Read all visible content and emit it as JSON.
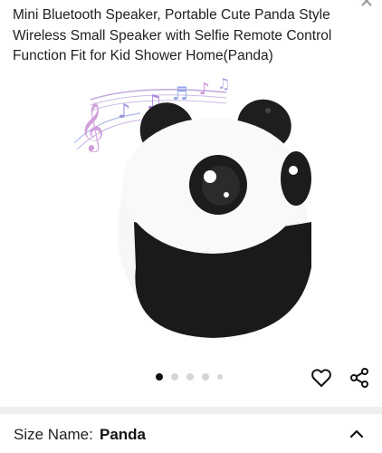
{
  "product": {
    "title": "Mini Bluetooth Speaker, Portable Cute Panda Style Wireless Small Speaker with Selfie Remote Control Function Fit for Kid Shower Home(Panda)"
  },
  "carousel": {
    "total_images": 5,
    "active_index": 0
  },
  "size_selector": {
    "label": "Size Name:",
    "value": "Panda"
  },
  "icons": {
    "wishlist": "heart-icon",
    "share": "share-icon",
    "expand": "chevron-up-icon"
  }
}
